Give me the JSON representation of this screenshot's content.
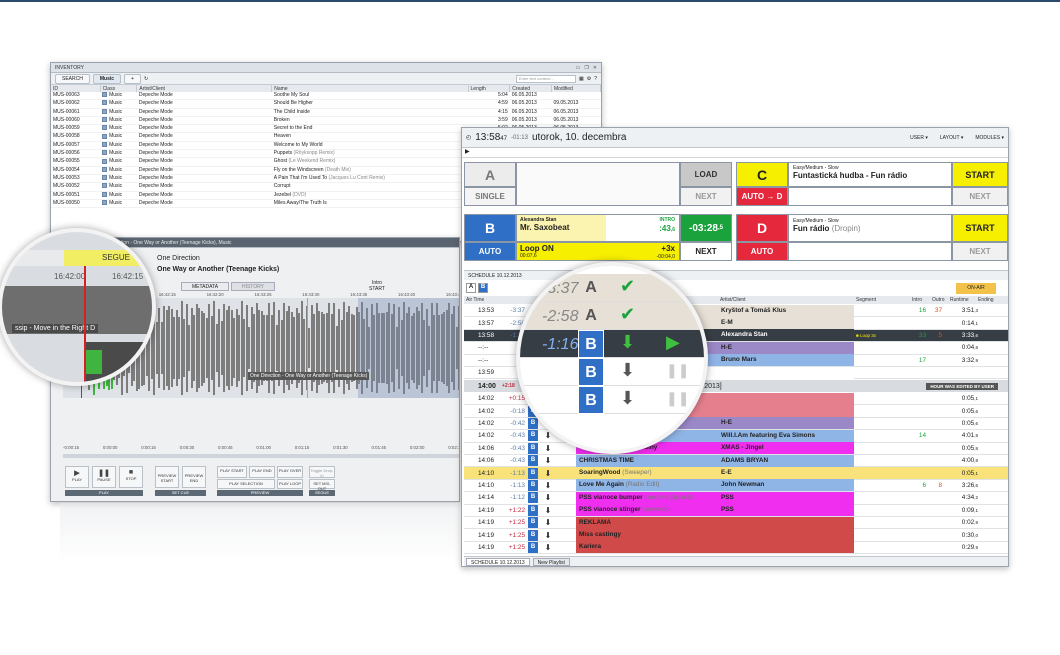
{
  "colors": {
    "blue": "#2f6fc5",
    "yellow": "#f7ef00",
    "red": "#e5283c",
    "green": "#1aa33c",
    "magenta": "#f02ef0",
    "pink": "#e57f8d",
    "purple": "#9b88c7",
    "lightblue": "#8fb4e6"
  },
  "inventory": {
    "title": "INVENTORY",
    "tab_search": "SEARCH",
    "tab_music": "Music",
    "add": "+",
    "search_placeholder": "Enter text content...",
    "columns": [
      "ID",
      "Class",
      "Artist/Client",
      "Name",
      "Length",
      "Created",
      "Modified"
    ],
    "rows": [
      [
        "MUS-00063",
        "Music",
        "Depeche Mode",
        "Soothe My Soul",
        "5:04",
        "06.05.2013",
        ""
      ],
      [
        "MUS-00062",
        "Music",
        "Depeche Mode",
        "Should Be Higher",
        "4:59",
        "06.05.2013",
        "09.05.2013"
      ],
      [
        "MUS-00061",
        "Music",
        "Depeche Mode",
        "The Child Inside",
        "4:15",
        "06.05.2013",
        "06.05.2013"
      ],
      [
        "MUS-00060",
        "Music",
        "Depeche Mode",
        "Broken",
        "3:59",
        "06.05.2013",
        "06.05.2013"
      ],
      [
        "MUS-00059",
        "Music",
        "Depeche Mode",
        "Secret to the End",
        "5:02",
        "06.05.2013",
        "06.05.2013"
      ],
      [
        "MUS-00058",
        "Music",
        "Depeche Mode",
        "Heaven",
        "3:58",
        "06.05.2013",
        "06.05.2013"
      ],
      [
        "MUS-00057",
        "Music",
        "Depeche Mode",
        "Welcome to My World",
        "4:59",
        "06.05.2013",
        "06.05.2013"
      ],
      [
        "MUS-00056",
        "Music",
        "Depeche Mode",
        "Puppets",
        "3:59",
        "06.05.2013",
        "06.05.2013"
      ],
      [
        "MUS-00055",
        "Music",
        "Depeche Mode",
        "Ghost",
        "8:19",
        "06.05.2013",
        "06.05.2013"
      ],
      [
        "MUS-00054",
        "Music",
        "Depeche Mode",
        "Fly on the Windscreen",
        "3:55",
        "06.05.2013",
        "06.05.2013"
      ],
      [
        "MUS-00053",
        "Music",
        "Depeche Mode",
        "A Pain That I'm Used To",
        "7:34",
        "06.05.2013",
        "06.05.2013"
      ],
      [
        "MUS-00052",
        "Music",
        "Depeche Mode",
        "Corrupt",
        "4:59",
        "06.05.2013",
        "06.05.2013"
      ],
      [
        "MUS-00051",
        "Music",
        "Depeche Mode",
        "Jezebel",
        "4:49",
        "06.05.2013",
        "06.05.2013"
      ],
      [
        "MUS-00050",
        "Music",
        "Depeche Mode",
        "Miles Away/The Truth Is",
        "3:53",
        "06.05.2013",
        "06.05.2013"
      ]
    ],
    "name_suffix": {
      "7": "(Röyksopp Remix)",
      "8": "(Le Weekend Remix)",
      "9": "(Death Mix)",
      "10": "(Jacques Lu Cont Remix)",
      "12": "(DVD)"
    }
  },
  "detail": {
    "title": "DETAIL - MDI-141: One Direction - One Way or Another (Teenage Kicks), Music",
    "artist": "One Direction",
    "song": "One Way or Another (Teenage Kicks)",
    "segue": "SEGUE",
    "t1": "16:42:00",
    "t2": "16:42:15",
    "metadata": "METADATA",
    "history": "HISTORY",
    "intro": "Intro",
    "start": "START",
    "prev_track": "ssip - Move in the Right D",
    "cur_track": "One Direction - One Way or Another (Teenage Kicks)",
    "ticks_top": [
      "16:42:05",
      "16:42:10",
      "16:42:15",
      "16:42:20",
      "16:43:25",
      "16:43:30",
      "16:43:35",
      "16:43:40",
      "16:43:45"
    ],
    "ticks_bot": [
      "-0:00:15",
      "0:00:00",
      "0:00:15",
      "0:00:30",
      "0:00:45",
      "0:01:00",
      "0:01:15",
      "0:01:30",
      "0:01:45",
      "0:02:00",
      "0:02:15"
    ],
    "btn_play": "PLAY",
    "btn_pause": "PAUSE",
    "btn_stop": "STOP",
    "btn_prev_start": "PREVIEW START",
    "btn_prev_end": "PREVIEW END",
    "btn_play_start": "PLAY START",
    "btn_play_end": "PLAY END",
    "btn_play_over": "PLAY OVER",
    "btn_toggle": "Toggle Drop-in",
    "btn_play_sel": "PLAY SELECTION",
    "btn_play_loop": "PLAY LOOP",
    "btn_set_mix": "SET MIX-OUT",
    "grp_play": "PLAY",
    "grp_setcue": "SET CUE",
    "grp_preview": "PREVIEW",
    "grp_segue": "SEGUE"
  },
  "scheduler": {
    "clock": "13:58",
    "clock_sec": "47",
    "offset": "-01:13",
    "date": "utorok, 10. decembra",
    "menu": [
      "USER",
      "LAYOUT",
      "MODULES"
    ],
    "cartA": "A",
    "single": "SINGLE",
    "load": "LOAD",
    "next": "NEXT",
    "cartC": "C",
    "auto_d": "AUTO → D",
    "c_info": "Easy/Medium - Slow",
    "c_title": "Funtastická hudba - Fun rádio",
    "start": "START",
    "cartB": "B",
    "auto": "AUTO",
    "b_artist": "Alexandra Stan",
    "b_title": "Mr. Saxobeat",
    "b_intro": "INTRO",
    "b_intro_val": ":43",
    "b_intro_frac": ",6",
    "b_remain": "-03:28",
    "b_remain_frac": ",5",
    "loop": "Loop ON",
    "loop_t": "00:07",
    "loop_t_frac": ",6",
    "loop_x": "+3x",
    "loop_rem": "-00:04",
    "loop_rem_frac": ",0",
    "cartD": "D",
    "d_info": "Easy/Medium - Slow",
    "d_title": "Fun rádio",
    "d_suffix": "(Dropin)",
    "schedule_title": "SCHEDULE 10.12.2013",
    "on_air": "ON-AIR",
    "cols": [
      "Air Time",
      "Artist/Client",
      "Segment",
      "Intro",
      "Outro",
      "Runtime",
      "Ending"
    ],
    "hour": "14:00",
    "hour_off": "+2:18",
    "hour_date": "10. 12. 2013]",
    "hour_note": "HOUR WAS EDITED BY USER",
    "prev_rows": [
      {
        "t": "13:53",
        "d": "-3:37",
        "ti": "",
        "ar": "Kryštof a Tomáš Klus",
        "in": "16",
        "ou": "37",
        "ru": "3:51",
        "rf": ",3",
        "bg": "#e6e0d6"
      },
      {
        "t": "13:57",
        "d": "-2:58",
        "ti": "",
        "ar": "E-M",
        "in": "",
        "ou": "",
        "ru": "0:14",
        "rf": ",1",
        "bg": "#e6e0d6"
      },
      {
        "t": "13:58",
        "d": "-1:16",
        "ti": "",
        "ar": "Alexandra Stan",
        "seg": "Loop 3x",
        "in": "33",
        "ou": "5",
        "ru": "3:33",
        "rf": ",6",
        "bg": "#363d44"
      },
      {
        "t": "--:--",
        "d": "",
        "ti": "",
        "ar": "H-E",
        "in": "",
        "ou": "",
        "ru": "0:04",
        "rf": ",8",
        "bg": "#9b88c7"
      },
      {
        "t": "--:--",
        "d": "",
        "ti": "",
        "ar": "Bruno Mars",
        "in": "17",
        "ou": "",
        "ru": "3:32",
        "rf": ",9",
        "bg": "#8fb4e6"
      },
      {
        "t": "13:59",
        "d": "",
        "ti": "",
        "ar": "",
        "in": "",
        "ou": "",
        "ru": "",
        "rf": "",
        "bg": "#ffffff"
      }
    ],
    "rows": [
      {
        "t": "14:02",
        "d": "+0:15",
        "ti": "",
        "ar": "",
        "in": "",
        "ou": "",
        "ru": "0:05",
        "rf": ",1",
        "bg": "#e57f8d"
      },
      {
        "t": "14:02",
        "d": "-0:18",
        "ti": "",
        "ar": "",
        "in": "",
        "ou": "",
        "ru": "0:05",
        "rf": ",6",
        "bg": "#e57f8d"
      },
      {
        "t": "14:02",
        "d": "-0:42",
        "ti": "",
        "ar": "H-E",
        "in": "",
        "ou": "",
        "ru": "0:05",
        "rf": ",6",
        "bg": "#9b88c7"
      },
      {
        "t": "14:02",
        "d": "-0:43",
        "ti": "",
        "ar": "Will.I.Am featuring Eva Simons",
        "in": "14",
        "ou": "",
        "ru": "4:01",
        "rf": ",9",
        "bg": "#8fb4e6"
      },
      {
        "t": "14:06",
        "d": "-0:43",
        "ti": "Vianoce - Od nášej rodiny",
        "ar": "XMAS - Jingel",
        "in": "",
        "ou": "",
        "ru": "0:05",
        "rf": ",8",
        "bg": "#f02ef0"
      },
      {
        "t": "14:06",
        "d": "-0:43",
        "ti": "CHRISTMAS TIME",
        "ar": "ADAMS BRYAN",
        "in": "",
        "ou": "",
        "ru": "4:00",
        "rf": ",8",
        "bg": "#8fb4e6"
      },
      {
        "t": "14:10",
        "d": "-1:13",
        "ti": "SoaringWood",
        "ts": "(Sweeper)",
        "ar": "E-E",
        "in": "",
        "ou": "",
        "ru": "0:05",
        "rf": ",1",
        "bg": "#f9e27a"
      },
      {
        "t": "14:10",
        "d": "-1:13",
        "ti": "Love Me Again",
        "ts": "(Radio Edit)",
        "ar": "John Newman",
        "in": "6",
        "ou": "8",
        "ru": "3:26",
        "rf": ",6",
        "bg": "#8fb4e6"
      },
      {
        "t": "14:14",
        "d": "-1:12",
        "ti": "PSS vianoce bumper",
        "ts": "Loosova plysniak",
        "ar": "PSS",
        "in": "",
        "ou": "",
        "ru": "4:34",
        "rf": ",2",
        "bg": "#f02ef0"
      },
      {
        "t": "14:19",
        "d": "+1:22",
        "ti": "PSS vianoce stinger",
        "ts": "Loosovap",
        "ar": "PSS",
        "in": "",
        "ou": "",
        "ru": "0:09",
        "rf": ",1",
        "bg": "#f02ef0"
      },
      {
        "t": "14:19",
        "d": "+1:25",
        "ti": "REKLAMA",
        "ar": "",
        "in": "",
        "ou": "",
        "ru": "0:02",
        "rf": ",9",
        "bg": "#d04a4a"
      },
      {
        "t": "14:19",
        "d": "+1:25",
        "ti": "Miss castingy",
        "ar": "",
        "in": "",
        "ou": "",
        "ru": "0:30",
        "rf": ",0",
        "bg": "#d04a4a"
      },
      {
        "t": "14:19",
        "d": "+1:25",
        "ti": "Kariera",
        "ar": "",
        "in": "",
        "ou": "",
        "ru": "0:29",
        "rf": ",9",
        "bg": "#d04a4a"
      }
    ],
    "tab1": "SCHEDULE 10.12.2013",
    "tab2": "New Playlist"
  },
  "mag2": {
    "rows": [
      {
        "d": "-3:37",
        "c": "A"
      },
      {
        "d": "-2:58",
        "c": "A"
      },
      {
        "d": "-1:16",
        "c": "B"
      },
      {
        "d": "",
        "c": "B"
      },
      {
        "d": "",
        "c": "B"
      }
    ]
  }
}
